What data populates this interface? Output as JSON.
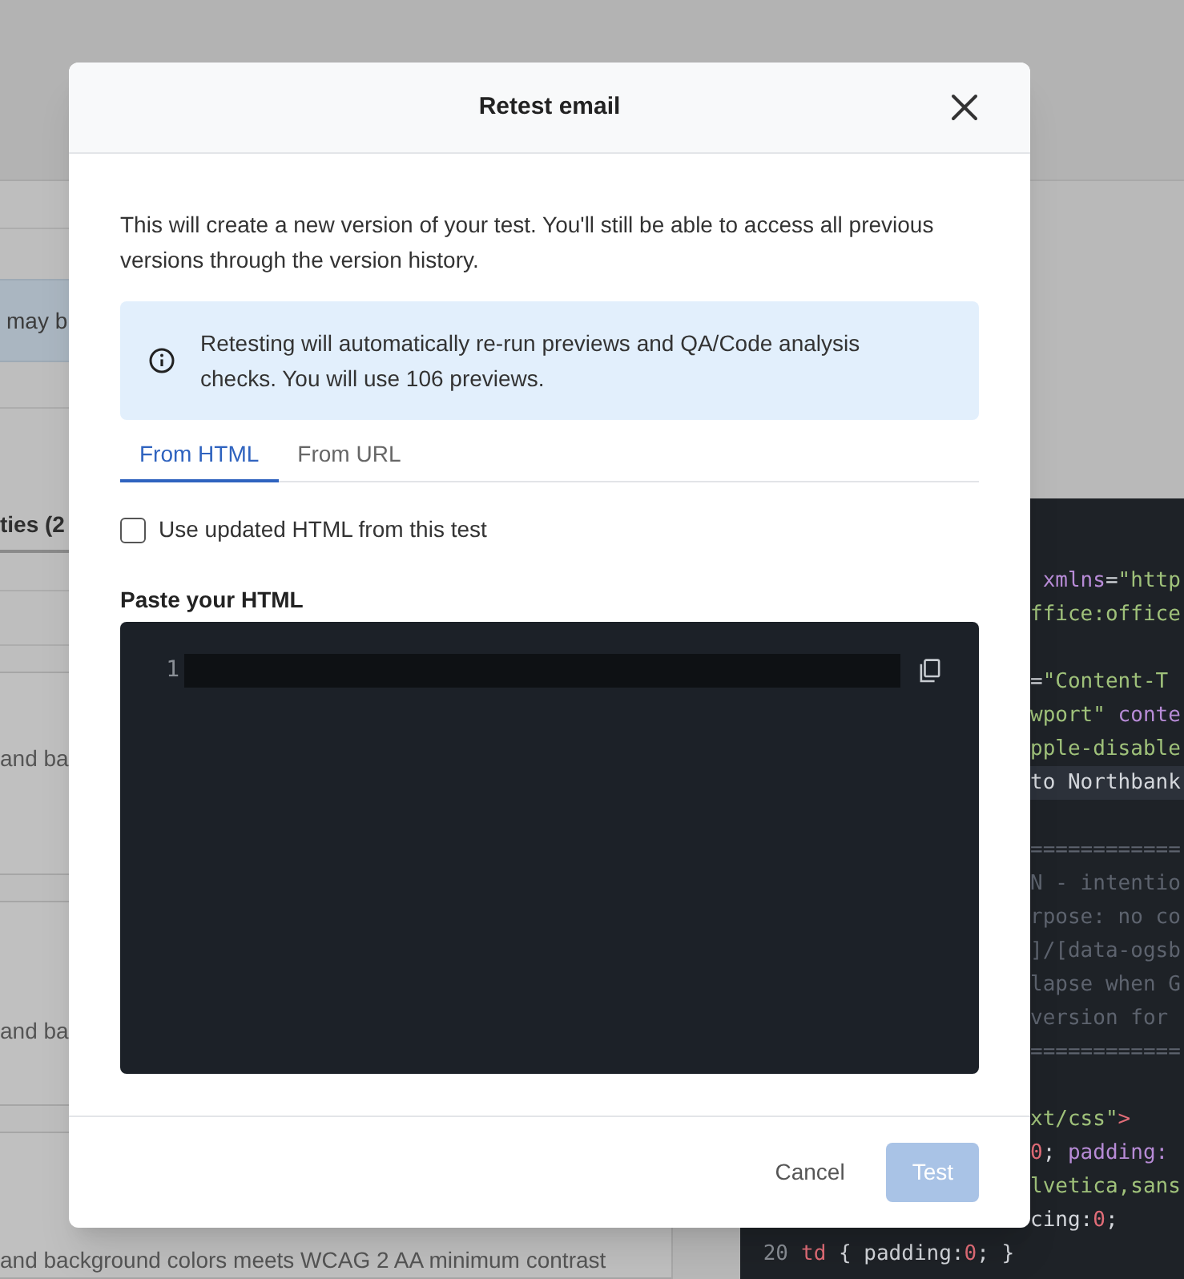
{
  "background": {
    "banner_text": "may b",
    "section_heading": "ties (2",
    "row_texts": [
      "and ba",
      "and ba",
      "and background colors meets WCAG 2 AA minimum contrast"
    ],
    "code_lines": [
      {
        "segments": [
          {
            "text": " xmlns",
            "kind": "attr"
          },
          {
            "text": "=",
            "kind": "plain"
          },
          {
            "text": "\"http",
            "kind": "string"
          }
        ]
      },
      {
        "segments": [
          {
            "text": "ffice:office",
            "kind": "string"
          }
        ]
      },
      {
        "gap_before": true,
        "segments": [
          {
            "text": "=",
            "kind": "plain"
          },
          {
            "text": "\"Content-T",
            "kind": "string"
          }
        ]
      },
      {
        "segments": [
          {
            "text": "wport\"",
            "kind": "string"
          },
          {
            "text": " conte",
            "kind": "attr"
          }
        ]
      },
      {
        "segments": [
          {
            "text": "pple-disable",
            "kind": "string"
          }
        ]
      },
      {
        "segments": [
          {
            "text": "to Northbank",
            "kind": "plain"
          }
        ],
        "highlighted": true
      },
      {
        "gap_before": true,
        "segments": [
          {
            "text": "============",
            "kind": "comment"
          }
        ]
      },
      {
        "segments": [
          {
            "text": "N - intentio",
            "kind": "comment"
          }
        ]
      },
      {
        "segments": [
          {
            "text": "rpose: no co",
            "kind": "comment"
          }
        ]
      },
      {
        "segments": [
          {
            "text": "]/[data-ogsb",
            "kind": "comment"
          }
        ]
      },
      {
        "segments": [
          {
            "text": "lapse when G",
            "kind": "comment"
          }
        ]
      },
      {
        "segments": [
          {
            "text": "version for",
            "kind": "comment"
          }
        ]
      },
      {
        "segments": [
          {
            "text": "============",
            "kind": "comment"
          }
        ]
      },
      {
        "gap_before": true,
        "segments": [
          {
            "text": "xt/css\"",
            "kind": "string"
          },
          {
            "text": ">",
            "kind": "tag"
          }
        ]
      },
      {
        "segments": [
          {
            "text": "0",
            "kind": "number"
          },
          {
            "text": "; ",
            "kind": "plain"
          },
          {
            "text": "padding:",
            "kind": "attr"
          }
        ]
      },
      {
        "segments": [
          {
            "text": "lvetica,sans",
            "kind": "string"
          }
        ]
      },
      {
        "segments": [
          {
            "text": "cing:",
            "kind": "plain"
          },
          {
            "text": "0",
            "kind": "number"
          },
          {
            "text": ";",
            "kind": "plain"
          }
        ]
      },
      {
        "number": "20",
        "segments": [
          {
            "text": "td",
            "kind": "tag"
          },
          {
            "text": " { padding:",
            "kind": "plain"
          },
          {
            "text": "0",
            "kind": "number"
          },
          {
            "text": "; }",
            "kind": "plain"
          }
        ]
      }
    ]
  },
  "dialog": {
    "title": "Retest email",
    "intro": "This will create a new version of your test. You'll still be able to access all previous versions through the version history.",
    "notice": "Retesting will automatically re-run previews and QA/Code analysis checks. You will use 106 previews.",
    "tabs": [
      {
        "label": "From HTML",
        "selected": true
      },
      {
        "label": "From URL",
        "selected": false
      }
    ],
    "checkbox": {
      "label": "Use updated HTML from this test",
      "checked": false
    },
    "editor": {
      "label": "Paste your HTML",
      "line_number": "1"
    },
    "buttons": [
      {
        "label": "Cancel",
        "kind": "secondary",
        "disabled": false
      },
      {
        "label": "Test",
        "kind": "primary",
        "disabled": true
      }
    ]
  }
}
